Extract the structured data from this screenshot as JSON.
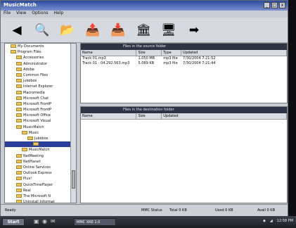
{
  "window": {
    "title": "MusicMatch"
  },
  "menu": [
    "File",
    "View",
    "Options",
    "Help"
  ],
  "toolbar": [
    {
      "name": "back-icon",
      "glyph": "◀"
    },
    {
      "name": "search-icon",
      "glyph": "🔍"
    },
    {
      "name": "folder-icon",
      "glyph": "📂"
    },
    {
      "name": "move-icon",
      "glyph": "📤"
    },
    {
      "name": "copy-icon",
      "glyph": "📥"
    },
    {
      "name": "bank-icon",
      "glyph": "🏛"
    },
    {
      "name": "display-icon",
      "glyph": "🖥"
    },
    {
      "name": "exit-icon",
      "glyph": "➡"
    }
  ],
  "tree": [
    "My Documents",
    "Program Files",
    "Accessories",
    "Administrator",
    "Adobe",
    "Common Files",
    "jukebox",
    "Internet Explorer",
    "Macromedia",
    "Microsoft Chat",
    "Microsoft FrontP",
    "Microsoft FrontP",
    "Microsoft Office",
    "Microsoft Visual",
    "MusicMatch",
    "Music",
    "Jukebox",
    "",
    "MusicMatch",
    "NetMeeting",
    "NetPlanet",
    "Online Services",
    "Outlook Express",
    "Plus!",
    "QuickTimePlayer",
    "Real",
    "The Microsoft N",
    "Uninstall Informat"
  ],
  "top_pane": {
    "header": "Files in the source folder",
    "columns": [
      "Name",
      "Size",
      "Type",
      "Updated"
    ],
    "rows": [
      {
        "name": "Track 01.mp3",
        "size": "1.050 MB",
        "type": "mp3 file",
        "updated": "7/30/2004 7:21:52"
      },
      {
        "name": "Track 01 - 04.292.563.mp3",
        "size": "5.089 KB",
        "type": "mp3 file",
        "updated": "7/30/2004 7:21:44"
      }
    ]
  },
  "bottom_pane": {
    "header": "Files in the destination folder",
    "columns": [
      "Name",
      "Size",
      "Updated"
    ]
  },
  "status": {
    "left": "Ready",
    "mmc": "MMC Status",
    "total": "Total 0 KB",
    "used": "Used 0 KB",
    "avail": "Avail 0 KB"
  },
  "taskbar": {
    "start": "Start",
    "task": "MMC XRE 1.0",
    "time": "12:58 PM"
  }
}
